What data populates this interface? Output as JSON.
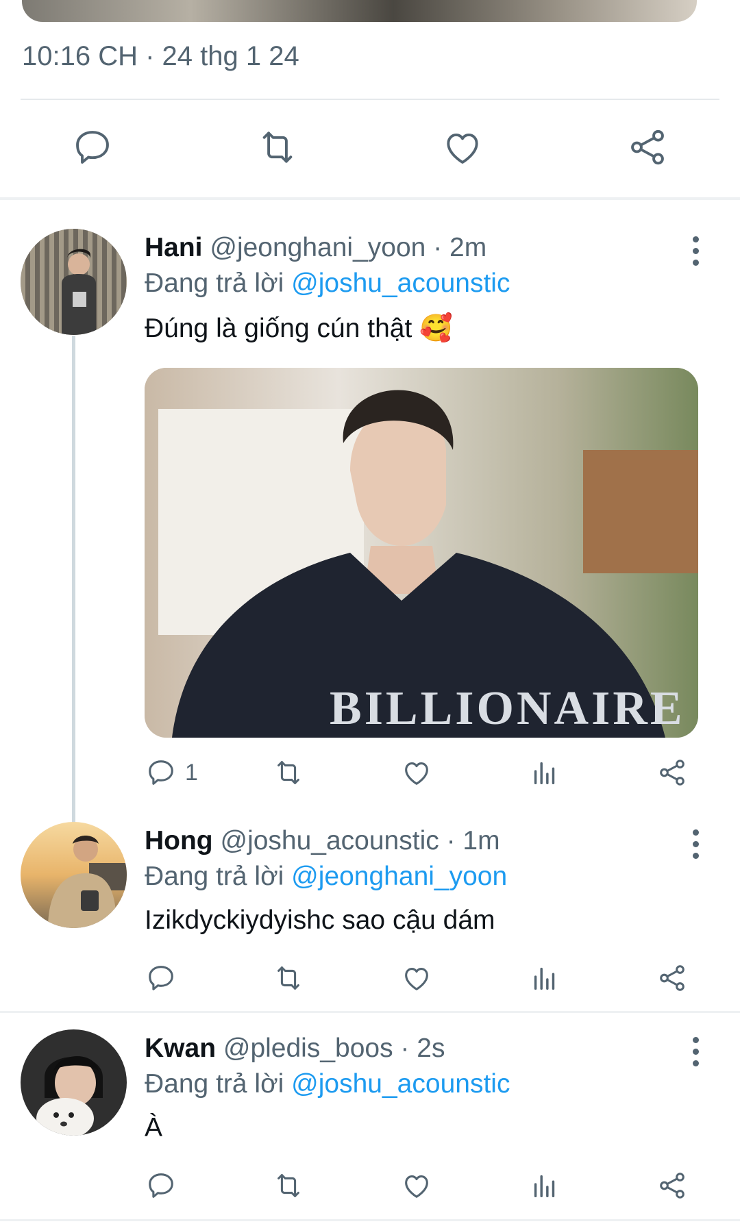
{
  "focused_tweet": {
    "timestamp": "10:16 CH · 24 thg 1 24"
  },
  "icons": {
    "reply": "reply-icon",
    "retweet": "retweet-icon",
    "like": "heart-icon",
    "share": "share-icon",
    "views": "views-icon",
    "more": "more-vertical-icon"
  },
  "colors": {
    "link": "#1d9bf0",
    "muted": "#536471",
    "text": "#0f1419",
    "thread_line": "#cfd9de"
  },
  "tweets": [
    {
      "name": "Hani",
      "meta": " @jeonghani_yoon · 2m",
      "reply_prefix": "Đang trả lời ",
      "reply_to": "@joshu_acounstic",
      "text": "Đúng là giống cún thật 🥰",
      "reply_count": "1"
    },
    {
      "name": "Hong",
      "meta": " @joshu_acounstic · 1m",
      "reply_prefix": "Đang trả lời ",
      "reply_to": "@jeonghani_yoon",
      "text": "Izikdyckiydyishc sao cậu dám",
      "reply_count": ""
    },
    {
      "name": "Kwan",
      "meta": " @pledis_boos · 2s",
      "reply_prefix": "Đang trả lời ",
      "reply_to": "@joshu_acounstic",
      "text": "À",
      "reply_count": ""
    }
  ]
}
